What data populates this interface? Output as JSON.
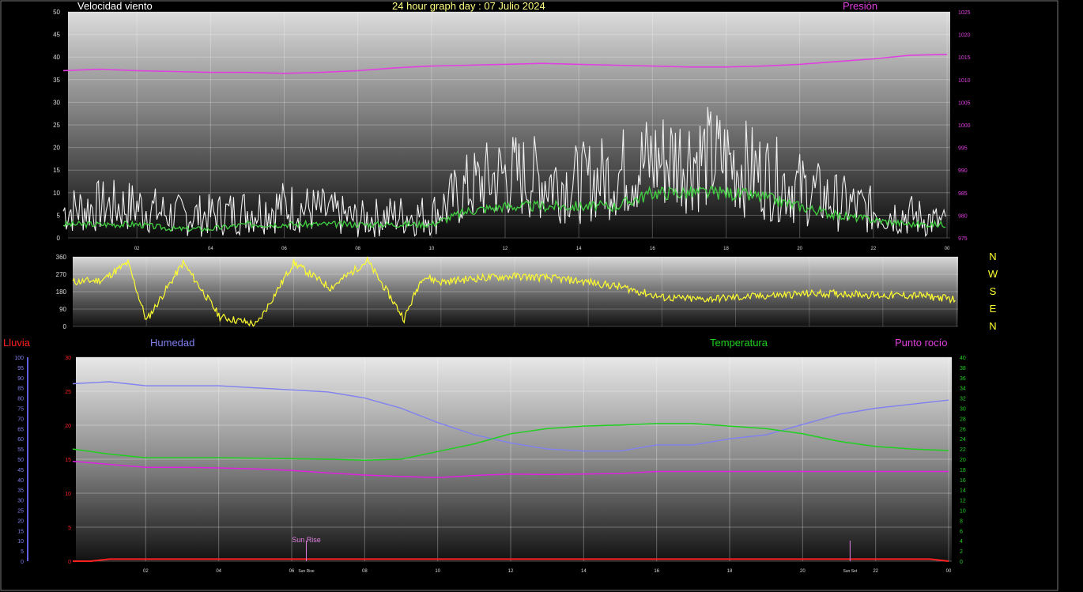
{
  "labels": {
    "wind": "Velocidad viento",
    "date": "24 hour graph day : 07 Julio 2024",
    "pressure": "Presión",
    "rain": "Lluvia",
    "humidity": "Humedad",
    "temperature": "Temperatura",
    "dewpoint": "Punto rocío",
    "sunrise": "Sun Rise",
    "sunset": "Sun Set",
    "compass": [
      "N",
      "W",
      "S",
      "E",
      "N"
    ]
  },
  "colors": {
    "wind": "#f0f0f0",
    "wind_avg": "#40d040",
    "pressure": "#e040e0",
    "direction": "#ffff30",
    "humidity": "#8080f0",
    "temperature": "#20d020",
    "dewpoint": "#e020e0",
    "rain": "#ff2020",
    "title": "#ffff80"
  },
  "chart_data": [
    {
      "type": "line",
      "name": "wind-pressure",
      "x_ticks": [
        "02",
        "04",
        "06",
        "08",
        "10",
        "12",
        "14",
        "16",
        "18",
        "20",
        "22",
        "00"
      ],
      "y_left": {
        "range": [
          0,
          50
        ],
        "ticks": [
          "0",
          "5",
          "10",
          "15",
          "20",
          "25",
          "30",
          "35",
          "40",
          "45",
          "50"
        ]
      },
      "y_right": {
        "range": [
          975,
          1025
        ],
        "ticks": [
          "975",
          "980",
          "985",
          "990",
          "995",
          "1000",
          "1005",
          "1010",
          "1015",
          "1020",
          "1025"
        ]
      },
      "series": [
        {
          "name": "Velocidad viento",
          "x": [
            0,
            1,
            2,
            3,
            4,
            5,
            6,
            7,
            8,
            9,
            10,
            11,
            12,
            13,
            14,
            15,
            16,
            17,
            18,
            19,
            20,
            21,
            22,
            23,
            24
          ],
          "values": [
            6,
            7,
            7,
            5,
            5,
            6,
            7,
            6,
            4,
            5,
            5,
            11,
            14,
            13,
            12,
            14,
            17,
            18,
            17,
            14,
            11,
            8,
            6,
            5,
            3
          ]
        },
        {
          "name": "",
          "x": [
            0,
            1,
            2,
            3,
            4,
            5,
            6,
            7,
            8,
            9,
            10,
            11,
            12,
            13,
            14,
            15,
            16,
            17,
            18,
            19,
            20,
            21,
            22,
            23,
            24
          ],
          "values": [
            3,
            3,
            3,
            2,
            2,
            3,
            3,
            3,
            3,
            3,
            3,
            6,
            7,
            7,
            7,
            7,
            10,
            10,
            10,
            9,
            7,
            5,
            4,
            3,
            3
          ]
        },
        {
          "name": "Presión",
          "x": [
            0,
            1,
            2,
            3,
            4,
            5,
            6,
            7,
            8,
            9,
            10,
            11,
            12,
            13,
            14,
            15,
            16,
            17,
            18,
            19,
            20,
            21,
            22,
            23,
            24
          ],
          "values": [
            1012,
            1012.3,
            1012,
            1011.8,
            1011.6,
            1011.6,
            1011.4,
            1011.6,
            1012,
            1012.6,
            1013,
            1013.2,
            1013.4,
            1013.6,
            1013.4,
            1013.2,
            1013,
            1012.8,
            1012.8,
            1013,
            1013.4,
            1014,
            1014.6,
            1015.4,
            1015.6
          ]
        }
      ]
    },
    {
      "type": "line",
      "name": "wind-direction",
      "y_ticks": [
        "0",
        "90",
        "180",
        "270",
        "360"
      ],
      "series": [
        {
          "name": "",
          "x": [
            0,
            0.8,
            1.5,
            2,
            3,
            4,
            5,
            6,
            7,
            8,
            9,
            9.5,
            10,
            11,
            12,
            13,
            14,
            15,
            16,
            17,
            18,
            19,
            20,
            21,
            22,
            23,
            24
          ],
          "values": [
            230,
            240,
            330,
            30,
            330,
            50,
            10,
            330,
            200,
            340,
            40,
            260,
            230,
            250,
            260,
            250,
            230,
            200,
            150,
            140,
            150,
            160,
            170,
            170,
            160,
            160,
            140
          ]
        }
      ]
    },
    {
      "type": "line",
      "name": "temp-humidity",
      "y_left": {
        "range": [
          0,
          30
        ],
        "ticks": [
          "0",
          "5",
          "10",
          "15",
          "20",
          "25",
          "30"
        ]
      },
      "y_rain": {
        "range": [
          0,
          100
        ],
        "ticks": [
          "0",
          "5",
          "10",
          "15",
          "20",
          "25",
          "30",
          "35",
          "40",
          "45",
          "50",
          "55",
          "60",
          "65",
          "70",
          "75",
          "80",
          "85",
          "90",
          "95",
          "100"
        ]
      },
      "y_right": {
        "range": [
          0,
          40
        ],
        "ticks": [
          "0",
          "2",
          "4",
          "6",
          "8",
          "10",
          "12",
          "14",
          "16",
          "18",
          "20",
          "22",
          "24",
          "26",
          "28",
          "30",
          "32",
          "34",
          "36",
          "38",
          "40"
        ]
      },
      "series": [
        {
          "name": "Humedad",
          "x": [
            0,
            1,
            2,
            3,
            4,
            5,
            6,
            7,
            8,
            9,
            10,
            11,
            12,
            13,
            14,
            15,
            16,
            17,
            18,
            19,
            20,
            21,
            22,
            23,
            24
          ],
          "values": [
            87,
            88,
            86,
            86,
            86,
            85,
            84,
            83,
            80,
            75,
            68,
            62,
            58,
            55,
            54,
            54,
            57,
            57,
            60,
            62,
            67,
            72,
            75,
            77,
            79
          ]
        },
        {
          "name": "Temperatura",
          "x": [
            0,
            1,
            2,
            3,
            4,
            5,
            6,
            7,
            8,
            9,
            10,
            11,
            12,
            13,
            14,
            15,
            16,
            17,
            18,
            19,
            20,
            21,
            22,
            23,
            24
          ],
          "values": [
            22,
            21,
            20.3,
            20.3,
            20.3,
            20.2,
            20.1,
            20,
            19.8,
            20,
            21.5,
            23,
            25,
            26,
            26.5,
            26.7,
            27,
            27,
            26.5,
            26,
            25,
            23.5,
            22.5,
            22,
            21.7
          ]
        },
        {
          "name": "Punto rocío",
          "x": [
            0,
            1,
            2,
            3,
            4,
            5,
            6,
            7,
            8,
            9,
            10,
            11,
            12,
            13,
            14,
            15,
            16,
            17,
            18,
            19,
            20,
            21,
            22,
            23,
            24
          ],
          "values": [
            19.6,
            19,
            18.4,
            18.4,
            18.3,
            18.1,
            17.8,
            17.3,
            16.9,
            16.6,
            16.4,
            16.8,
            17.1,
            17,
            17.1,
            17.2,
            17.6,
            17.6,
            17.6,
            17.6,
            17.6,
            17.6,
            17.6,
            17.6,
            17.6
          ]
        },
        {
          "name": "Lluvia",
          "x": [
            0,
            0.5,
            1,
            23.5,
            24
          ],
          "values": [
            0,
            0,
            1,
            1,
            0
          ]
        }
      ],
      "markers": [
        {
          "label": "Sun Rise",
          "x": 6.4
        },
        {
          "label": "Sun Set",
          "x": 21.3
        }
      ]
    }
  ]
}
